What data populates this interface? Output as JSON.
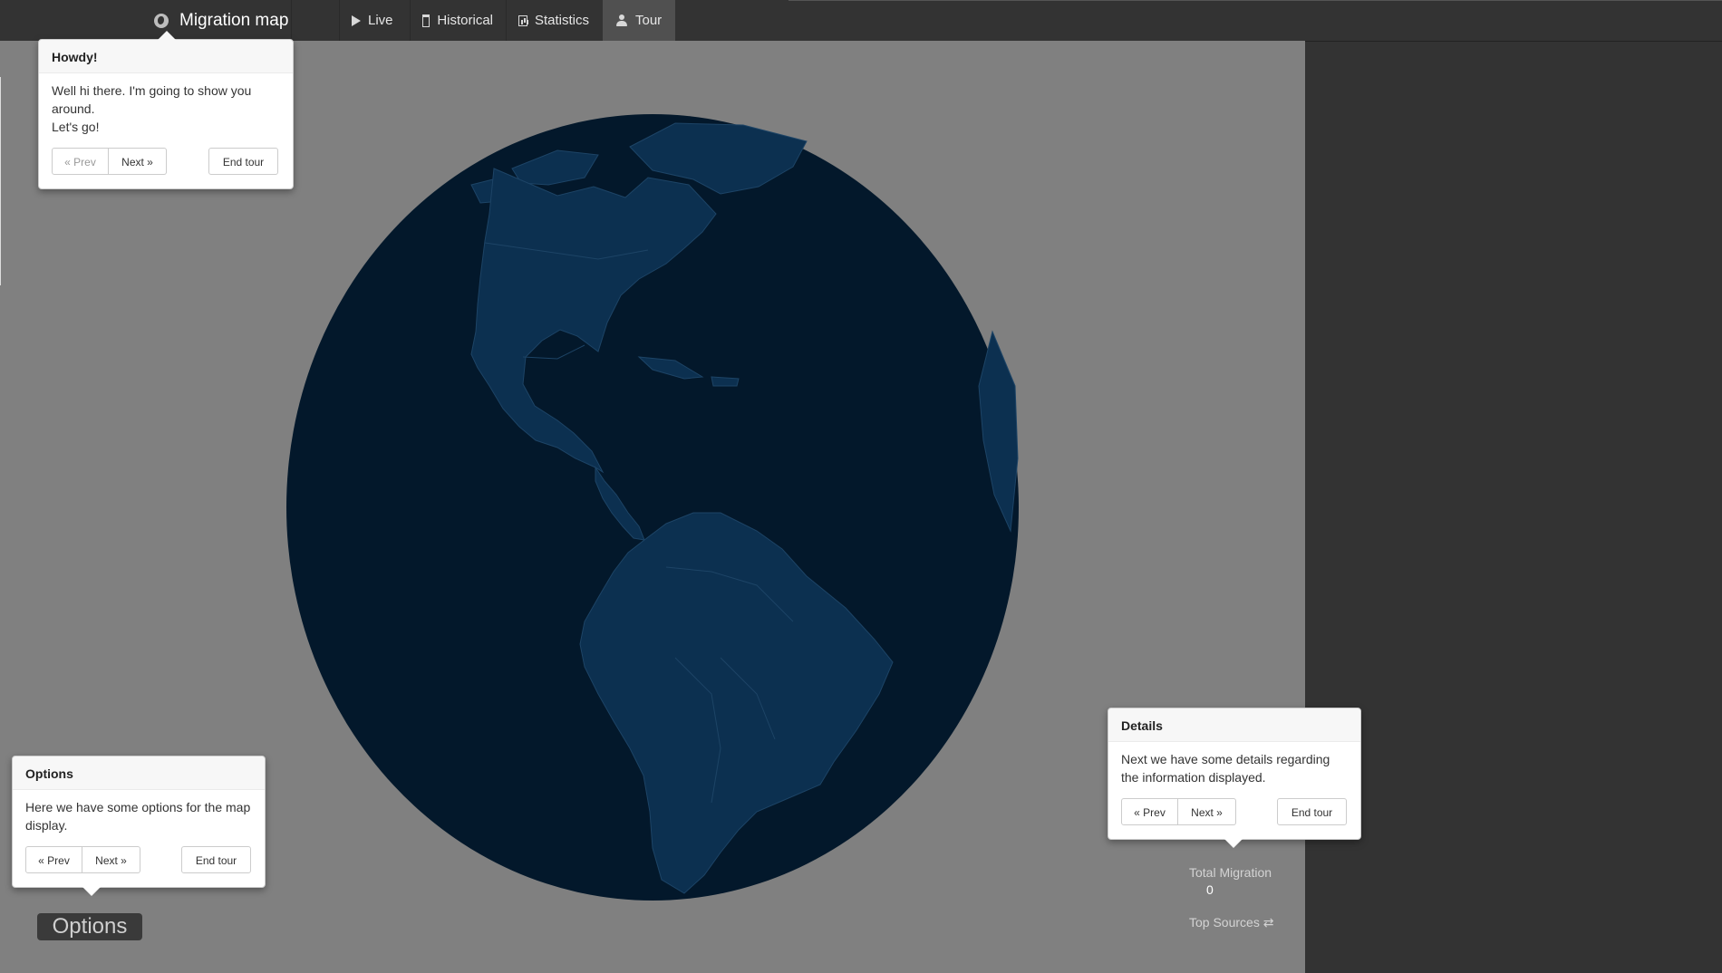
{
  "brand": {
    "title": "Migration map",
    "icon": "globe-icon"
  },
  "nav": {
    "items": [
      {
        "label": "Live",
        "icon": "play-icon",
        "active": false
      },
      {
        "label": "Historical",
        "icon": "calendar-icon",
        "active": false
      },
      {
        "label": "Statistics",
        "icon": "bar-chart-icon",
        "active": false
      },
      {
        "label": "Tour",
        "icon": "user-icon",
        "active": true
      }
    ]
  },
  "tour": {
    "howdy": {
      "title": "Howdy!",
      "body_line1": "Well hi there. I'm going to show you around.",
      "body_line2": "Let's go!",
      "prev_label": "« Prev",
      "next_label": "Next »",
      "end_label": "End tour"
    },
    "options": {
      "title": "Options",
      "body": "Here we have some options for the map display.",
      "prev_label": "« Prev",
      "next_label": "Next »",
      "end_label": "End tour"
    },
    "details": {
      "title": "Details",
      "body": "Next we have some details regarding the information displayed.",
      "prev_label": "« Prev",
      "next_label": "Next »",
      "end_label": "End tour"
    }
  },
  "options_button": {
    "label": "Options"
  },
  "details": {
    "total_migration_label": "Total Migration",
    "total_migration_value": "0",
    "top_sources_label": "Top Sources ⇄"
  },
  "colors": {
    "navbar": "#333333",
    "map_background": "#808080",
    "ocean": "#03182b",
    "land": "#0c3050",
    "border": "#1d4466"
  }
}
